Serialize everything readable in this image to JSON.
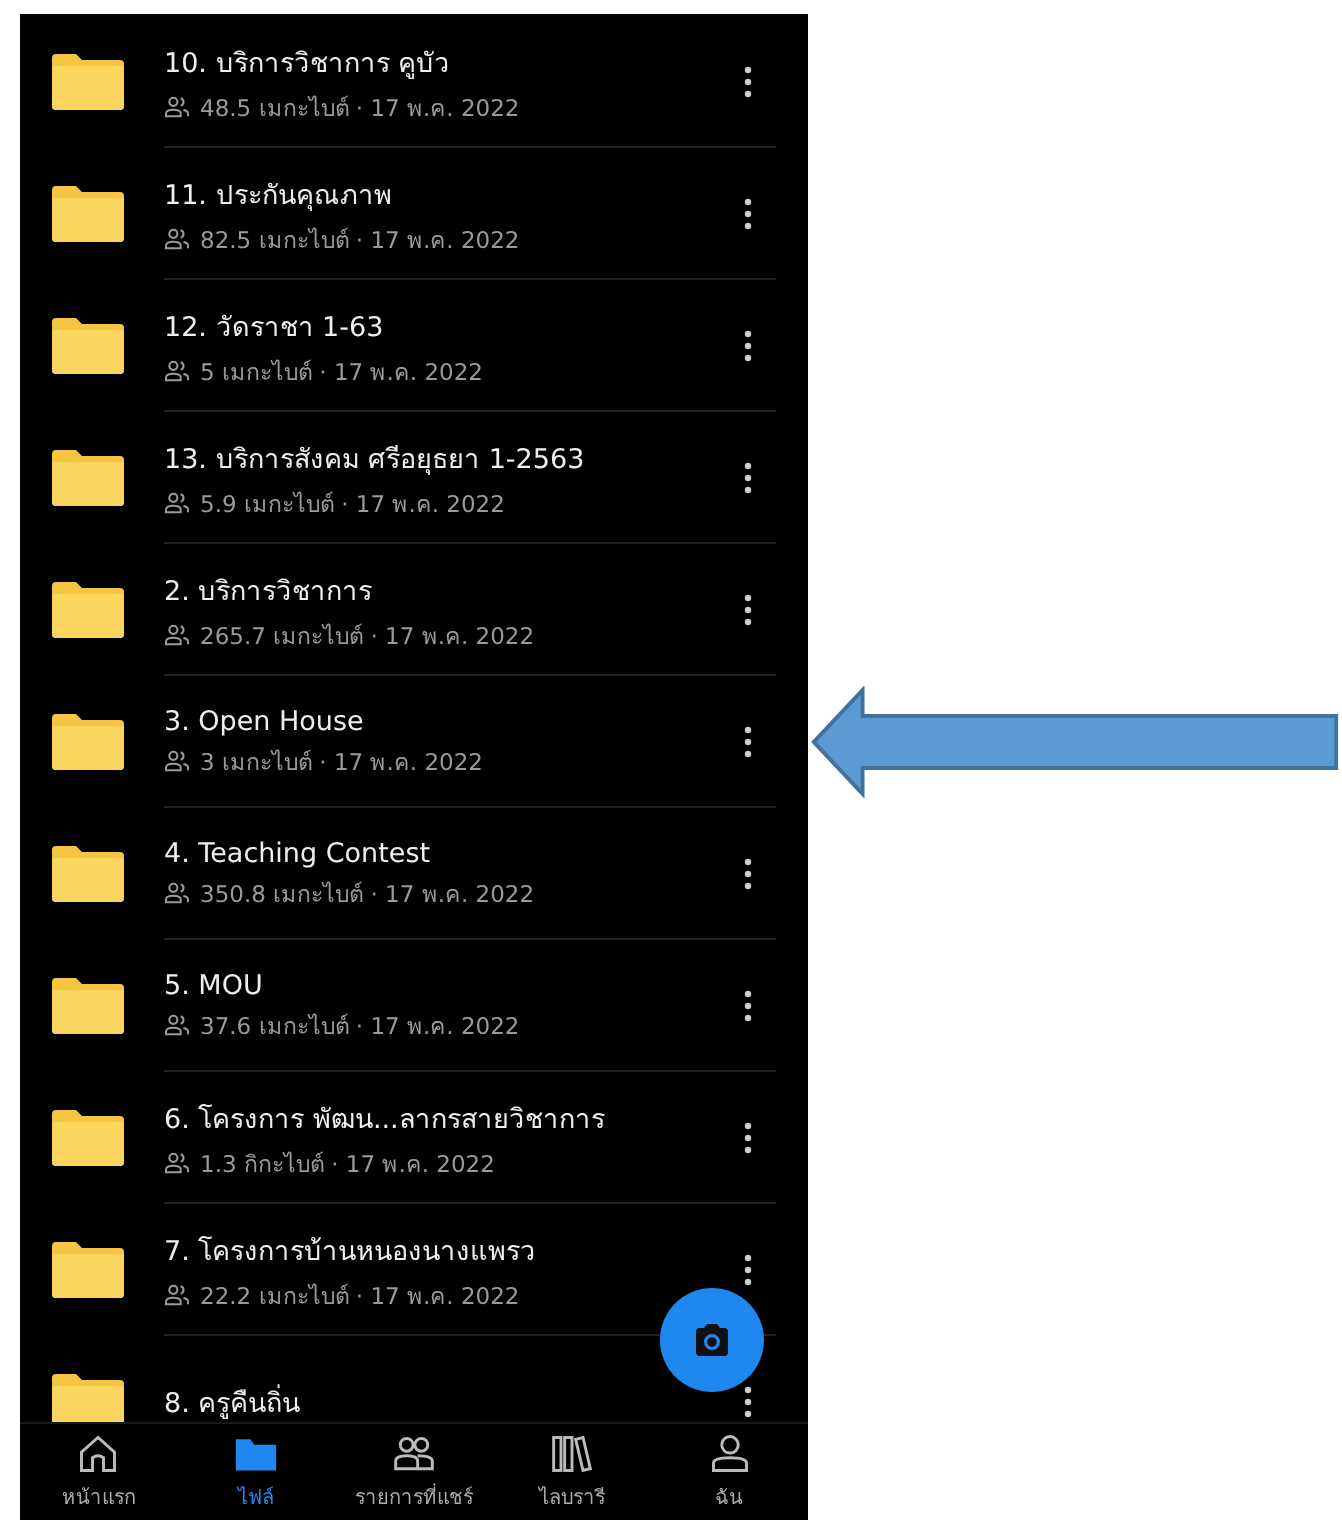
{
  "files": [
    {
      "name": "10. บริการวิชาการ คูบัว",
      "meta": "48.5 เมกะไบต์ · 17 พ.ค. 2022"
    },
    {
      "name": "11. ประกันคุณภาพ",
      "meta": "82.5 เมกะไบต์ · 17 พ.ค. 2022"
    },
    {
      "name": "12. วัดราชา 1-63",
      "meta": "5 เมกะไบต์ · 17 พ.ค. 2022"
    },
    {
      "name": "13. บริการสังคม ศรีอยุธยา 1-2563",
      "meta": "5.9 เมกะไบต์ · 17 พ.ค. 2022"
    },
    {
      "name": "2. บริการวิชาการ",
      "meta": "265.7 เมกะไบต์ · 17 พ.ค. 2022"
    },
    {
      "name": "3. Open House",
      "meta": "3 เมกะไบต์ · 17 พ.ค. 2022"
    },
    {
      "name": "4. Teaching Contest",
      "meta": "350.8 เมกะไบต์ · 17 พ.ค. 2022"
    },
    {
      "name": "5. MOU",
      "meta": "37.6 เมกะไบต์ · 17 พ.ค. 2022"
    },
    {
      "name": "6. โครงการ พัฒน...ลากรสายวิชาการ",
      "meta": "1.3 กิกะไบต์ · 17 พ.ค. 2022"
    },
    {
      "name": "7. โครงการบ้านหนองนางแพรว",
      "meta": "22.2 เมกะไบต์ · 17 พ.ค. 2022"
    },
    {
      "name": "8. ครูคืนถิ่น"
    }
  ],
  "nav": [
    {
      "label": "หน้าแรก",
      "kind": "home",
      "selected": false
    },
    {
      "label": "ไฟล์",
      "kind": "files",
      "selected": true
    },
    {
      "label": "รายการที่แชร์",
      "kind": "shared",
      "selected": false
    },
    {
      "label": "ไลบรารี",
      "kind": "library",
      "selected": false
    },
    {
      "label": "ฉัน",
      "kind": "me",
      "selected": false
    }
  ]
}
